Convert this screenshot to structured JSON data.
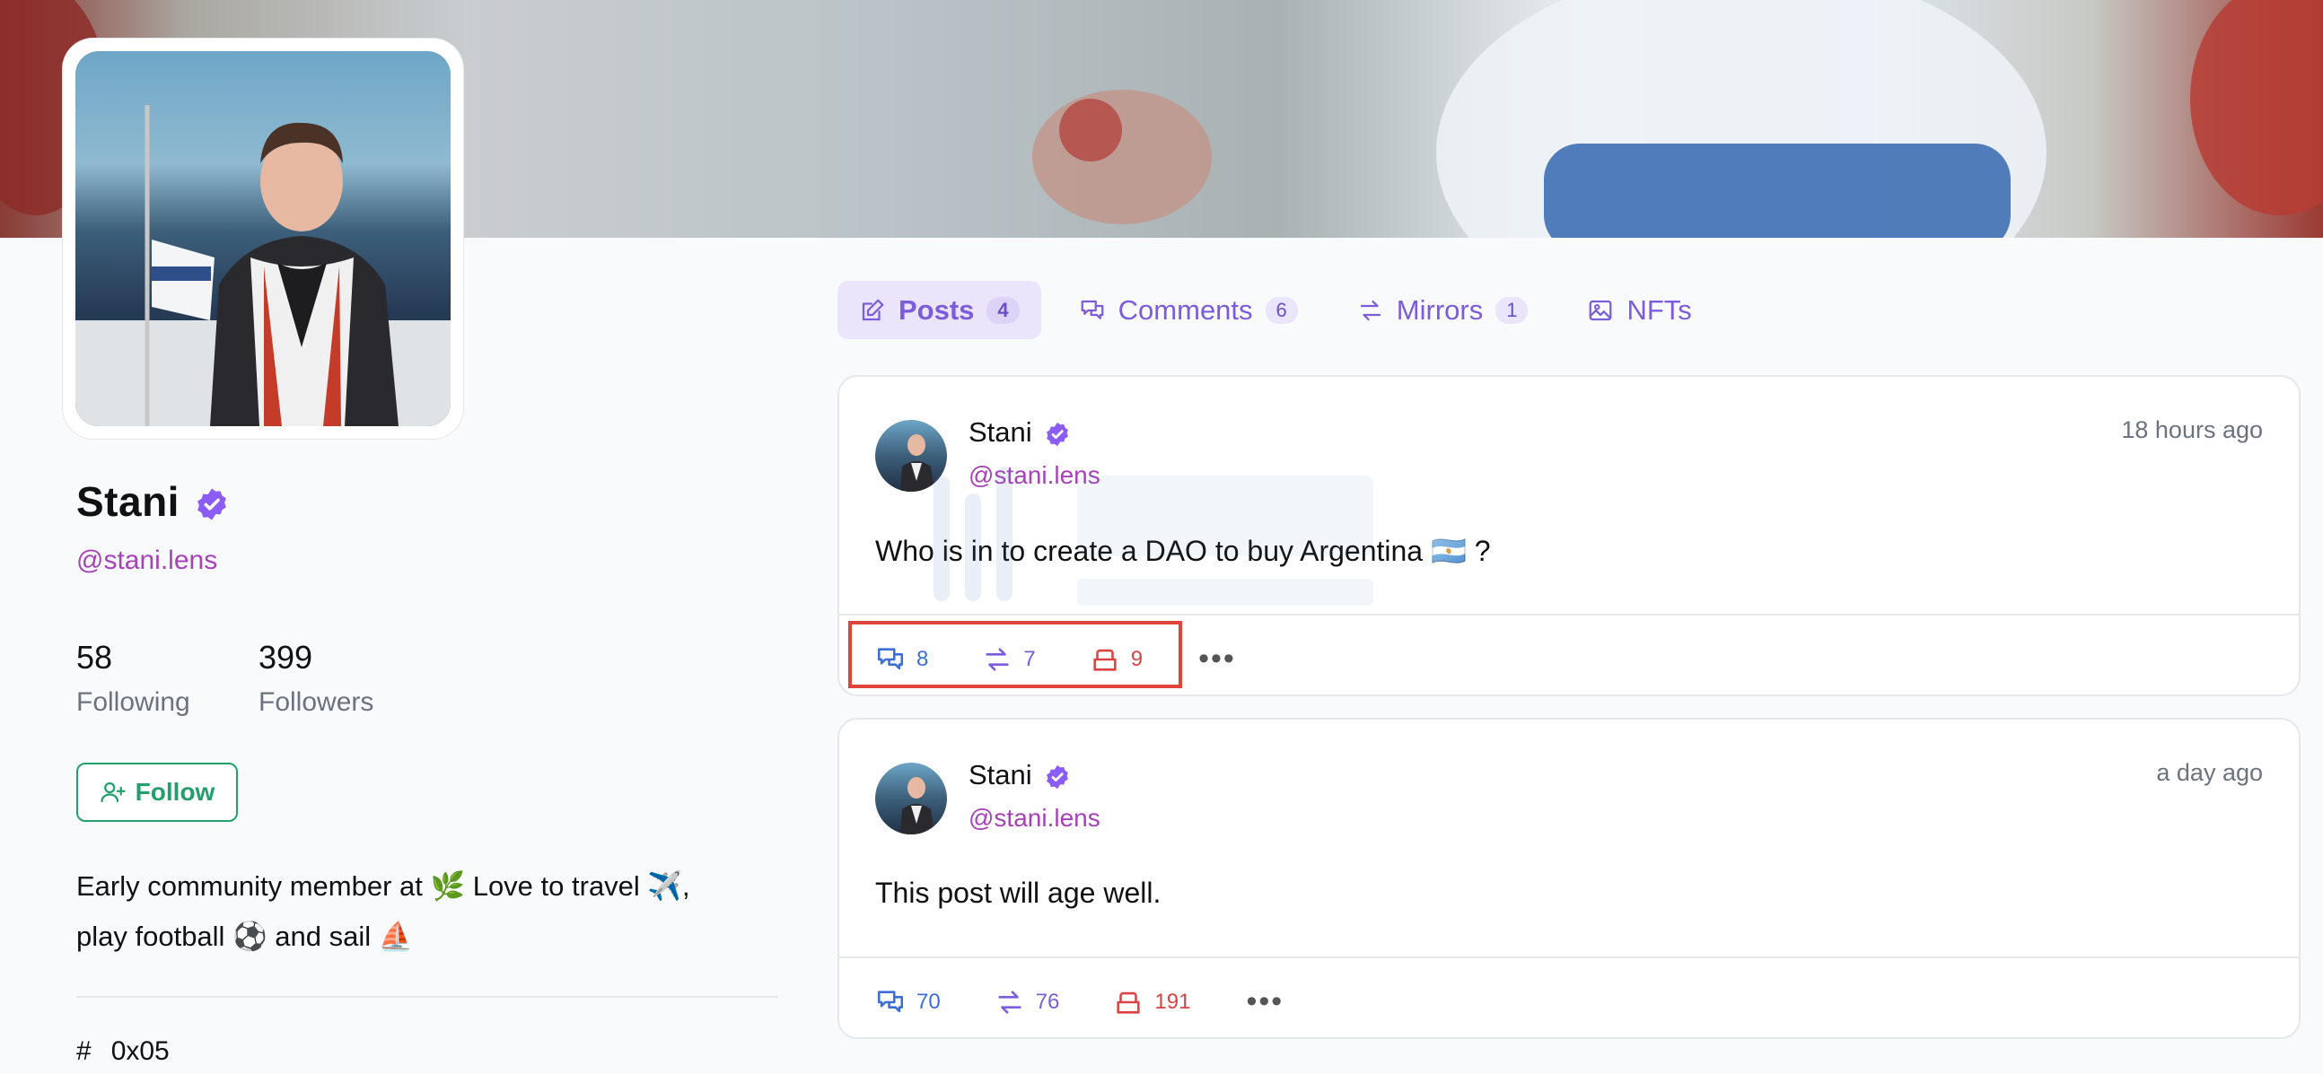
{
  "profile": {
    "name": "Stani",
    "handle": "@stani.lens",
    "following_count": "58",
    "following_label": "Following",
    "followers_count": "399",
    "followers_label": "Followers",
    "follow_button": "Follow",
    "bio_line1": "Early community member at 🌿 Love to travel ✈️,",
    "bio_line2": "play football ⚽ and sail ⛵",
    "id_symbol": "#",
    "id_value": "0x05"
  },
  "tabs": [
    {
      "label": "Posts",
      "count": "4",
      "icon": "pencil-square-icon",
      "active": true
    },
    {
      "label": "Comments",
      "count": "6",
      "icon": "chat-bubbles-icon",
      "active": false
    },
    {
      "label": "Mirrors",
      "count": "1",
      "icon": "arrows-switch-icon",
      "active": false
    },
    {
      "label": "NFTs",
      "count": "",
      "icon": "photo-icon",
      "active": false
    }
  ],
  "posts": [
    {
      "author": "Stani",
      "handle": "@stani.lens",
      "time": "18 hours ago",
      "text": "Who is in to create a DAO to buy Argentina 🇦🇷 ?",
      "comments": "8",
      "mirrors": "7",
      "collects": "9"
    },
    {
      "author": "Stani",
      "handle": "@stani.lens",
      "time": "a day ago",
      "text": "This post will age well.",
      "comments": "70",
      "mirrors": "76",
      "collects": "191"
    }
  ],
  "colors": {
    "accent": "#7c5cdb",
    "handle": "#a742b8",
    "follow": "#22a06b",
    "comment": "#3b6fd6",
    "collect": "#d94343",
    "highlight": "#e0433a"
  }
}
